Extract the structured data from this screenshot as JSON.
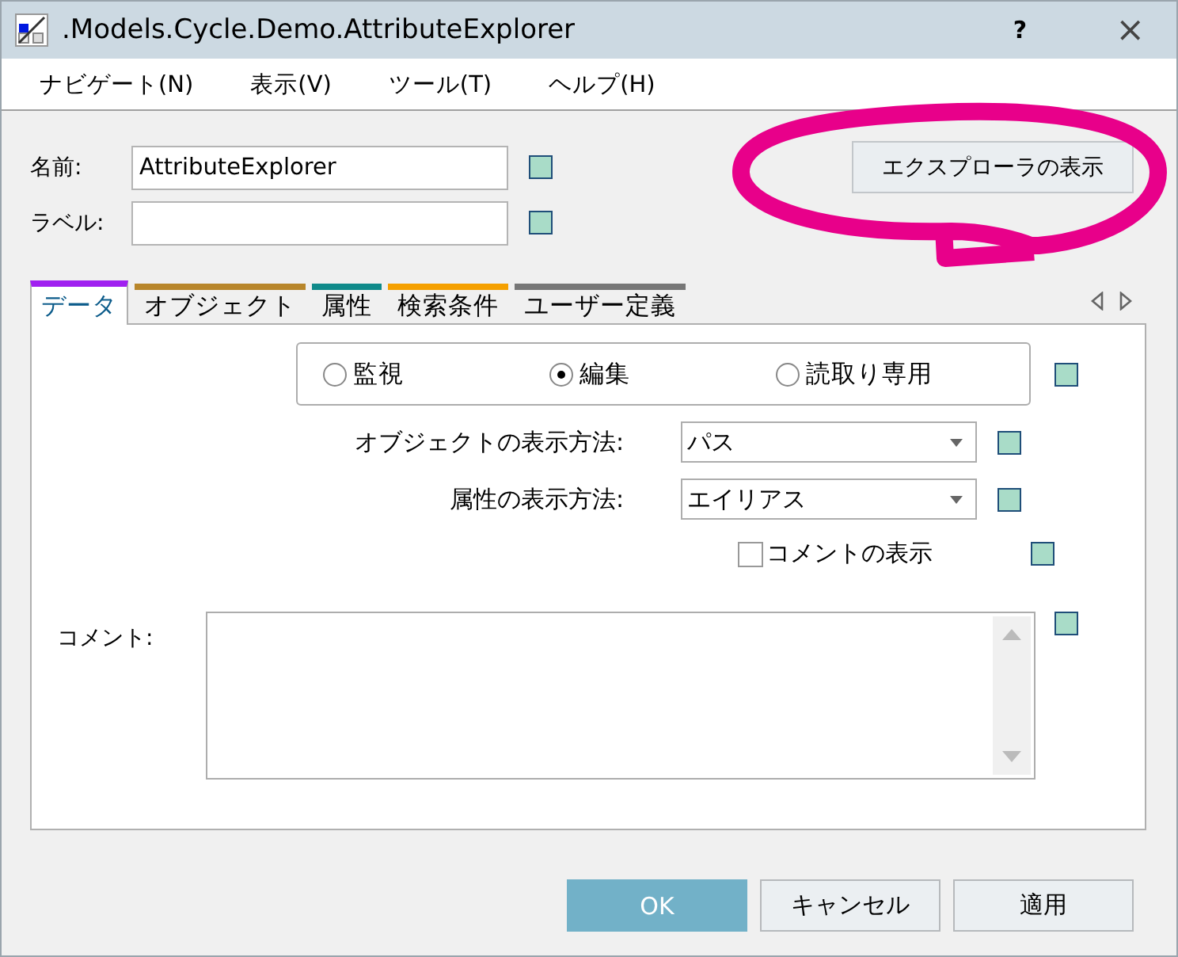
{
  "window": {
    "title": ".Models.Cycle.Demo.AttributeExplorer",
    "help": "?",
    "close": "×"
  },
  "menu": [
    {
      "label": "ナビゲート(N)"
    },
    {
      "label": "表示(V)"
    },
    {
      "label": "ツール(T)"
    },
    {
      "label": "ヘルプ(H)"
    }
  ],
  "name_field": {
    "label": "名前:",
    "value": "AttributeExplorer"
  },
  "label_field": {
    "label": "ラベル:"
  },
  "explorer_button": {
    "label": "エクスプローラの表示"
  },
  "highlight": {
    "kind": "ellipse"
  },
  "tabs": [
    {
      "label": "データ",
      "selected": true,
      "color": "#a020f0"
    },
    {
      "label": "オブジェクト",
      "selected": false,
      "color": "#b8862b"
    },
    {
      "label": "属性",
      "selected": false,
      "color": "#0f8a8a"
    },
    {
      "label": "検索条件",
      "selected": false,
      "color": "#f5a000"
    },
    {
      "label": "ユーザー定義",
      "selected": false,
      "color": "#777777"
    }
  ],
  "mode_options": [
    {
      "label": "監視",
      "selected": false
    },
    {
      "label": "編集",
      "selected": true
    },
    {
      "label": "読取り専用",
      "selected": false
    }
  ],
  "object_display": {
    "label": "オブジェクトの表示方法:",
    "value": "パス"
  },
  "attribute_display": {
    "label": "属性の表示方法:",
    "value": "エイリアス"
  },
  "show_comment": {
    "label": "コメントの表示",
    "checked": false
  },
  "comment": {
    "label": "コメント:"
  },
  "buttons": [
    {
      "label": "OK",
      "kind": "primary"
    },
    {
      "label": "キャンセル",
      "kind": "normal"
    },
    {
      "label": "適用",
      "kind": "normal"
    }
  ]
}
